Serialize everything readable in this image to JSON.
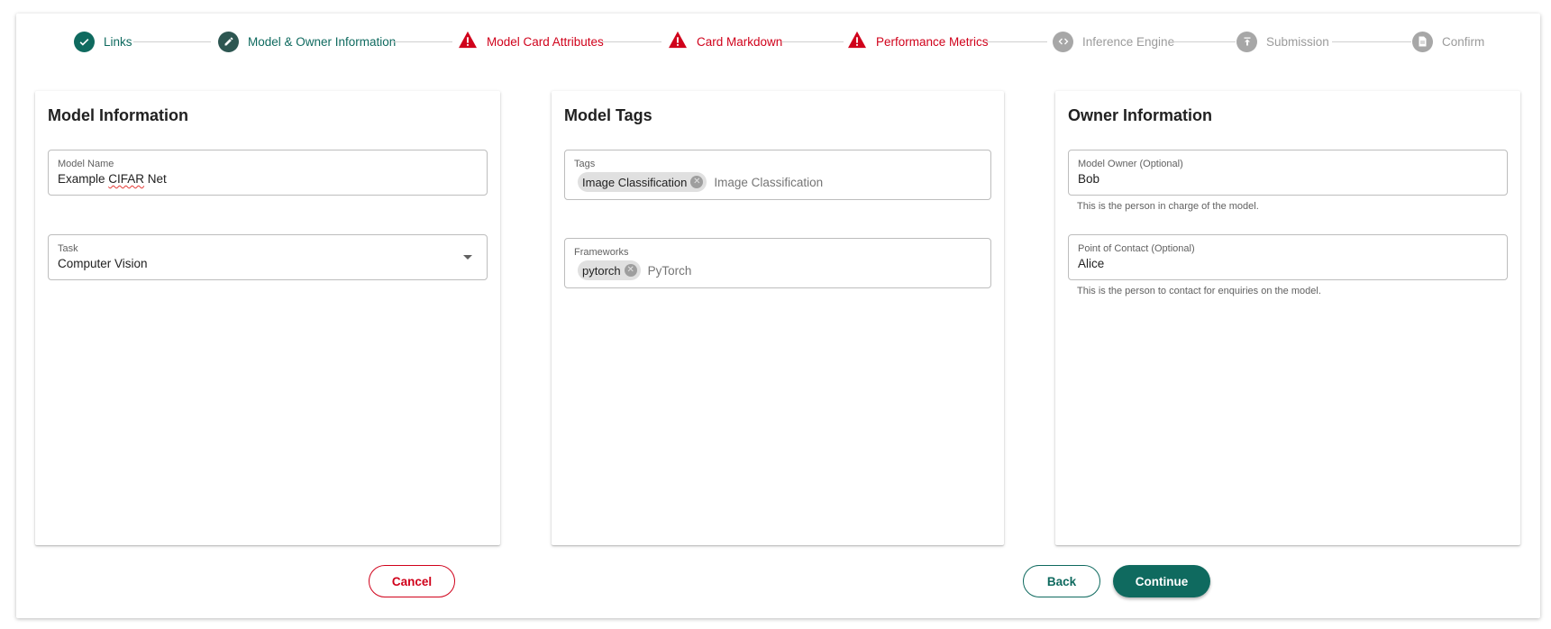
{
  "stepper": {
    "steps": [
      {
        "label": "Links",
        "status": "done"
      },
      {
        "label": "Model & Owner Information",
        "status": "active"
      },
      {
        "label": "Model Card Attributes",
        "status": "error"
      },
      {
        "label": "Card Markdown",
        "status": "error"
      },
      {
        "label": "Performance Metrics",
        "status": "error"
      },
      {
        "label": "Inference Engine",
        "status": "todo"
      },
      {
        "label": "Submission",
        "status": "todo"
      },
      {
        "label": "Confirm",
        "status": "todo"
      }
    ]
  },
  "model_info": {
    "title": "Model Information",
    "model_name": {
      "label": "Model Name",
      "value_prefix": "Example ",
      "value_misspelled": "CIFAR",
      "value_suffix": " Net"
    },
    "task": {
      "label": "Task",
      "value": "Computer Vision"
    }
  },
  "model_tags": {
    "title": "Model Tags",
    "tags": {
      "label": "Tags",
      "chip": "Image Classification",
      "input_value": "Image Classification"
    },
    "frameworks": {
      "label": "Frameworks",
      "chip": "pytorch",
      "input_value": "PyTorch"
    }
  },
  "owner_info": {
    "title": "Owner Information",
    "owner": {
      "label": "Model Owner (Optional)",
      "value": "Bob",
      "helper": "This is the person in charge of the model."
    },
    "contact": {
      "label": "Point of Contact (Optional)",
      "value": "Alice",
      "helper": "This is the person to contact for enquiries on the model."
    }
  },
  "actions": {
    "cancel": "Cancel",
    "back": "Back",
    "continue": "Continue"
  },
  "colors": {
    "primary": "#0f6a5f",
    "error": "#d0021b",
    "disabled": "#a7a7a7"
  }
}
